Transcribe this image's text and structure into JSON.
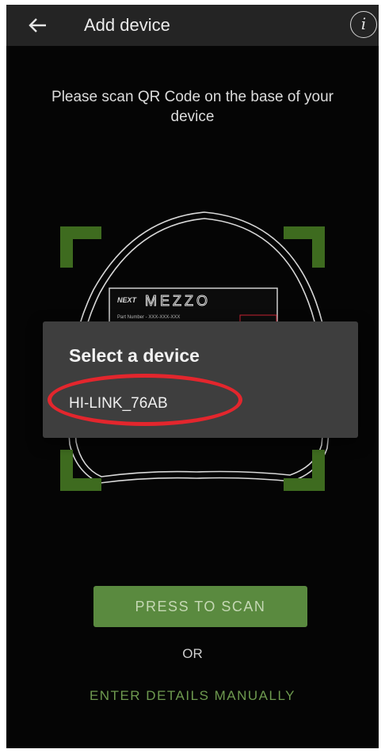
{
  "header": {
    "back_icon": "arrow-left-icon",
    "title": "Add device",
    "info_icon": "info-icon",
    "info_glyph": "i"
  },
  "instruction": "Please scan QR Code on the base of your device",
  "scanner": {
    "frame_color": "#3e6b1f",
    "label_brand": "MEZZO",
    "label_part_number": "Part Number - XXX-XXX-XXX"
  },
  "dialog": {
    "title": "Select a device",
    "devices": [
      {
        "label": "HI-LINK_76AB"
      }
    ],
    "highlight_color": "#e3262d"
  },
  "actions": {
    "scan_label": "PRESS TO SCAN",
    "or_label": "OR",
    "manual_label": "ENTER DETAILS MANUALLY"
  },
  "colors": {
    "accent": "#5a8a3f",
    "background": "#050505",
    "appbar": "#242424",
    "dialog": "#3e3e3e"
  }
}
